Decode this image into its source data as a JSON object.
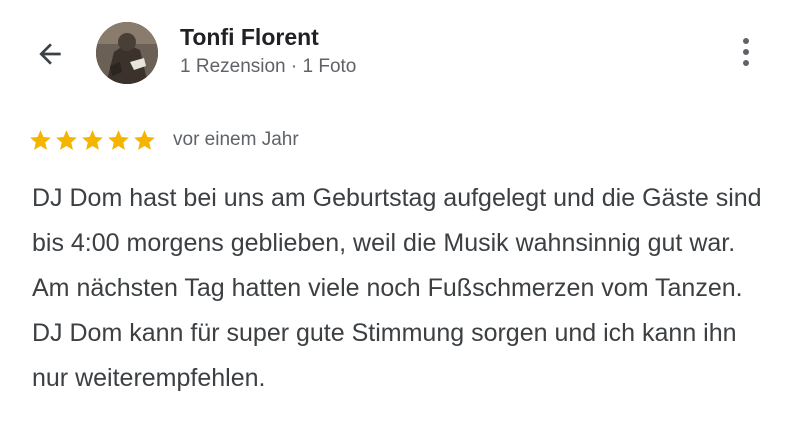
{
  "header": {
    "author_name": "Tonfi Florent",
    "author_meta": "1 Rezension · 1 Foto",
    "back_icon": "arrow-left-icon",
    "menu_icon": "more-vertical-icon"
  },
  "review": {
    "rating": 5,
    "rating_max": 5,
    "date": "vor einem Jahr",
    "text": "DJ Dom hast bei uns am Geburtstag aufgelegt und die Gäste sind bis 4:00 morgens geblieben, weil die Musik wahnsinnig gut war. Am nächsten Tag hatten viele noch Fußschmerzen vom Tanzen. DJ Dom kann für super gute Stimmung sorgen und ich kann ihn nur weiterempfehlen."
  },
  "colors": {
    "star": "#F4B400",
    "primary_text": "#202124",
    "secondary_text": "#5f6368",
    "body_text": "#3c4043"
  }
}
